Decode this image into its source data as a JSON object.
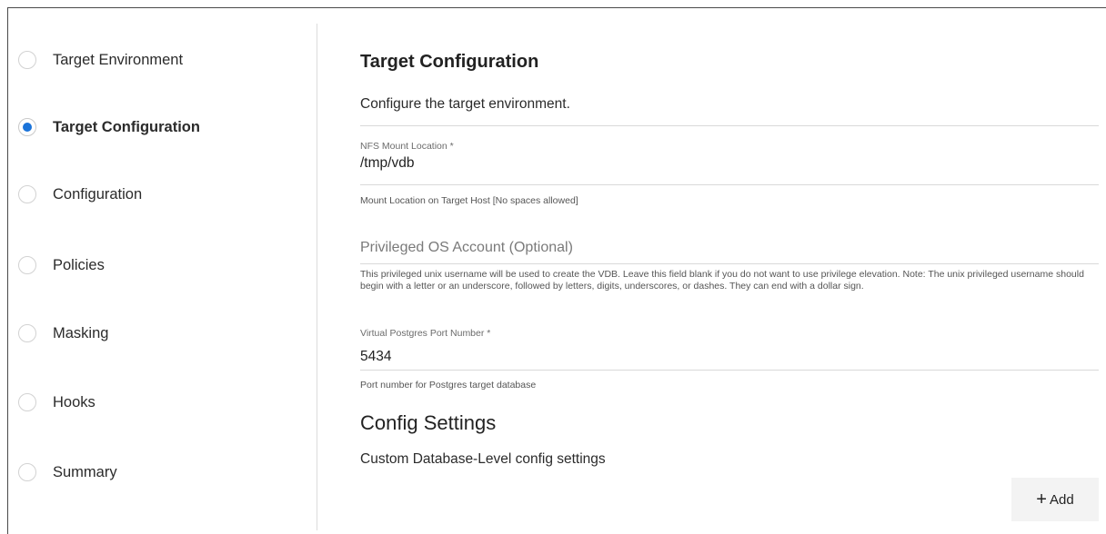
{
  "wizard": {
    "steps": [
      {
        "label": "Target Environment",
        "active": false
      },
      {
        "label": "Target Configuration",
        "active": true
      },
      {
        "label": "Configuration",
        "active": false
      },
      {
        "label": "Policies",
        "active": false
      },
      {
        "label": "Masking",
        "active": false
      },
      {
        "label": "Hooks",
        "active": false
      },
      {
        "label": "Summary",
        "active": false
      }
    ],
    "active_color": "#1a73d9"
  },
  "main": {
    "title": "Target Configuration",
    "subtitle": "Configure the target environment.",
    "nfs_mount": {
      "label": "NFS Mount Location *",
      "value": "/tmp/vdb",
      "helper": "Mount Location on Target Host [No spaces allowed]"
    },
    "privileged_account": {
      "placeholder": "Privileged OS Account (Optional)",
      "value": "",
      "helper": "This privileged unix username will be used to create the VDB. Leave this field blank if you do not want to use privilege elevation. Note: The unix privileged username should begin with a letter or an underscore, followed by letters, digits, underscores, or dashes. They can end with a dollar sign."
    },
    "port": {
      "label": "Virtual Postgres Port Number *",
      "value": "5434",
      "helper": "Port number for Postgres target database"
    },
    "config_settings": {
      "title": "Config Settings",
      "description": "Custom Database-Level config settings",
      "add_label": "Add",
      "add_icon": "plus-icon"
    }
  }
}
